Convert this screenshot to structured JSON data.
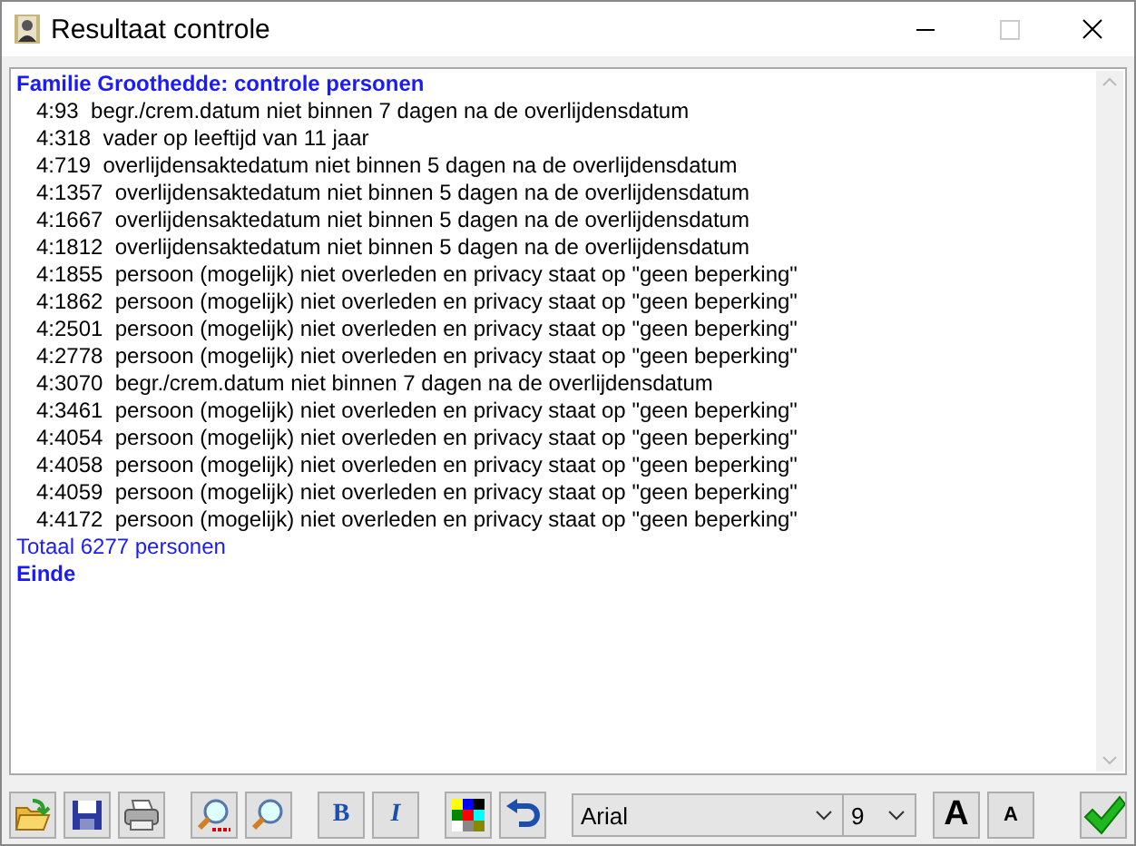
{
  "window": {
    "title": "Resultaat controle"
  },
  "lines": [
    {
      "kind": "heading",
      "text": "Familie Groothedde: controle personen"
    },
    {
      "kind": "item",
      "text": "4:93  begr./crem.datum niet binnen 7 dagen na de overlijdensdatum"
    },
    {
      "kind": "item",
      "text": "4:318  vader op leeftijd van 11 jaar"
    },
    {
      "kind": "item",
      "text": "4:719  overlijdensaktedatum niet binnen 5 dagen na de overlijdensdatum"
    },
    {
      "kind": "item",
      "text": "4:1357  overlijdensaktedatum niet binnen 5 dagen na de overlijdensdatum"
    },
    {
      "kind": "item",
      "text": "4:1667  overlijdensaktedatum niet binnen 5 dagen na de overlijdensdatum"
    },
    {
      "kind": "item",
      "text": "4:1812  overlijdensaktedatum niet binnen 5 dagen na de overlijdensdatum"
    },
    {
      "kind": "item",
      "text": "4:1855  persoon (mogelijk) niet overleden en privacy staat op \"geen beperking\""
    },
    {
      "kind": "item",
      "text": "4:1862  persoon (mogelijk) niet overleden en privacy staat op \"geen beperking\""
    },
    {
      "kind": "item",
      "text": "4:2501  persoon (mogelijk) niet overleden en privacy staat op \"geen beperking\""
    },
    {
      "kind": "item",
      "text": "4:2778  persoon (mogelijk) niet overleden en privacy staat op \"geen beperking\""
    },
    {
      "kind": "item",
      "text": "4:3070  begr./crem.datum niet binnen 7 dagen na de overlijdensdatum"
    },
    {
      "kind": "item",
      "text": "4:3461  persoon (mogelijk) niet overleden en privacy staat op \"geen beperking\""
    },
    {
      "kind": "item",
      "text": "4:4054  persoon (mogelijk) niet overleden en privacy staat op \"geen beperking\""
    },
    {
      "kind": "item",
      "text": "4:4058  persoon (mogelijk) niet overleden en privacy staat op \"geen beperking\""
    },
    {
      "kind": "item",
      "text": "4:4059  persoon (mogelijk) niet overleden en privacy staat op \"geen beperking\""
    },
    {
      "kind": "item",
      "text": "4:4172  persoon (mogelijk) niet overleden en privacy staat op \"geen beperking\""
    },
    {
      "kind": "total",
      "text": "Totaal 6277 personen"
    },
    {
      "kind": "end",
      "text": "Einde"
    }
  ],
  "toolbar": {
    "bold_label": "B",
    "italic_label": "I",
    "font": "Arial",
    "size": "9",
    "larger_label": "A",
    "smaller_label": "A"
  }
}
